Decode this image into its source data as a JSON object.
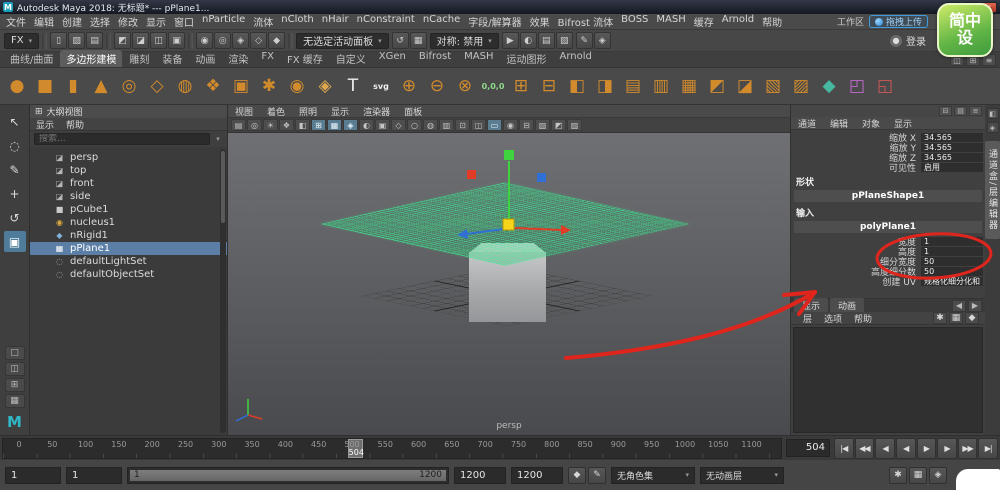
{
  "titlebar": {
    "app_initial": "M",
    "title": "Autodesk Maya 2018: 无标题* --- pPlane1...",
    "window_buttons": {
      "minimize": "─",
      "maximize": "□",
      "close": "×"
    }
  },
  "menubar": {
    "items": [
      "文件",
      "编辑",
      "创建",
      "选择",
      "修改",
      "显示",
      "窗口",
      "nParticle",
      "流体",
      "nCloth",
      "nHair",
      "nConstraint",
      "nCache",
      "字段/解算器",
      "效果",
      "Bifrost 流体",
      "BOSS",
      "MASH",
      "缓存",
      "Arnold",
      "帮助"
    ],
    "workspace_label": "工作区",
    "upload_button": "拖拽上传"
  },
  "statusline": {
    "menuset": "FX",
    "groups": {
      "file": [
        {
          "name": "new-scene",
          "g": "▯"
        },
        {
          "name": "open-scene",
          "g": "▨"
        },
        {
          "name": "save-scene",
          "g": "▤"
        }
      ],
      "selection": [
        {
          "name": "select-hierarchy",
          "g": "◩"
        },
        {
          "name": "select-object",
          "g": "◪"
        },
        {
          "name": "select-component",
          "g": "◫"
        },
        {
          "name": "highlight-mode",
          "g": "▣"
        }
      ],
      "snap": [
        {
          "name": "snap-grid",
          "g": "◉"
        },
        {
          "name": "snap-curve",
          "g": "◎"
        },
        {
          "name": "snap-point",
          "g": "◈"
        },
        {
          "name": "snap-plane",
          "g": "◇"
        },
        {
          "name": "snap-view",
          "g": "◆"
        }
      ],
      "history": [
        {
          "name": "construction-history",
          "g": "↺"
        },
        {
          "name": "list-inputs",
          "g": "▦"
        }
      ],
      "render": [
        {
          "name": "render-current-frame",
          "g": "▶"
        },
        {
          "name": "ipr-render",
          "g": "◐"
        },
        {
          "name": "render-settings",
          "g": "▤"
        },
        {
          "name": "display-layer",
          "g": "▧"
        }
      ],
      "extra": [
        {
          "name": "paint-effects",
          "g": "✎"
        },
        {
          "name": "hypershade",
          "g": "◈"
        }
      ]
    },
    "active_panel": "无选定活动面板",
    "symmetry": "对称: 禁用",
    "login_label": "登录"
  },
  "shelf": {
    "tabs": [
      "曲线/曲面",
      "多边形建模",
      "雕刻",
      "装备",
      "动画",
      "渲染",
      "FX",
      "FX 缓存",
      "自定义",
      "XGen",
      "Bifrost",
      "MASH",
      "运动图形",
      "Arnold"
    ],
    "active_index": 1,
    "icons": [
      {
        "name": "poly-sphere",
        "g": "●",
        "c": "#d28b2c"
      },
      {
        "name": "poly-cube",
        "g": "■",
        "c": "#d28b2c"
      },
      {
        "name": "poly-cylinder",
        "g": "▮",
        "c": "#d28b2c"
      },
      {
        "name": "poly-cone",
        "g": "▲",
        "c": "#d28b2c"
      },
      {
        "name": "poly-torus",
        "g": "◎",
        "c": "#d28b2c"
      },
      {
        "name": "poly-plane",
        "g": "◇",
        "c": "#d28b2c"
      },
      {
        "name": "poly-disc",
        "g": "◍",
        "c": "#d28b2c"
      },
      {
        "name": "poly-platonic",
        "g": "❖",
        "c": "#d28b2c"
      },
      {
        "name": "poly-pipe",
        "g": "▣",
        "c": "#d28b2c"
      },
      {
        "name": "poly-helix",
        "g": "✱",
        "c": "#d28b2c"
      },
      {
        "name": "poly-gear",
        "g": "◉",
        "c": "#d28b2c"
      },
      {
        "name": "poly-super-shape",
        "g": "◈",
        "c": "#e0a84e"
      },
      {
        "name": "type-tool",
        "g": "T",
        "c": "#f0f0f0"
      },
      {
        "name": "svg-tool",
        "g": "svg",
        "c": "#f0f0f0"
      },
      {
        "name": "boolean-union",
        "g": "⊕",
        "c": "#d28b2c"
      },
      {
        "name": "boolean-difference",
        "g": "⊖",
        "c": "#d28b2c"
      },
      {
        "name": "boolean-intersection",
        "g": "⊗",
        "c": "#d28b2c"
      },
      {
        "name": "snap-to-origin",
        "g": "0,0,0",
        "c": "#8fd98b"
      },
      {
        "name": "combine",
        "g": "⊞",
        "c": "#d28b2c"
      },
      {
        "name": "separate",
        "g": "⊟",
        "c": "#d28b2c"
      },
      {
        "name": "extrude",
        "g": "◧",
        "c": "#d28b2c"
      },
      {
        "name": "bevel",
        "g": "◨",
        "c": "#d28b2c"
      },
      {
        "name": "bridge",
        "g": "▤",
        "c": "#d28b2c"
      },
      {
        "name": "multi-cut",
        "g": "▥",
        "c": "#d28b2c"
      },
      {
        "name": "quad-draw",
        "g": "▦",
        "c": "#d28b2c"
      },
      {
        "name": "mirror",
        "g": "◩",
        "c": "#d28b2c"
      },
      {
        "name": "smooth",
        "g": "◪",
        "c": "#d28b2c"
      },
      {
        "name": "reduce",
        "g": "▧",
        "c": "#d28b2c"
      },
      {
        "name": "spin-edge",
        "g": "▨",
        "c": "#d28b2c"
      },
      {
        "name": "target-weld",
        "g": "◆",
        "c": "#46b8a0"
      },
      {
        "name": "project-curve",
        "g": "◰",
        "c": "#c46ad2"
      },
      {
        "name": "align",
        "g": "◱",
        "c": "#d25858"
      }
    ],
    "right_icons": [
      {
        "name": "shelf-editor",
        "g": "◫"
      },
      {
        "name": "shelf-grid",
        "g": "⊞"
      },
      {
        "name": "shelf-options",
        "g": "≡"
      }
    ]
  },
  "toolbox": {
    "tools": [
      {
        "name": "select-tool",
        "g": "↖",
        "selected": false
      },
      {
        "name": "lasso-select-tool",
        "g": "◌",
        "selected": false
      },
      {
        "name": "paint-select-tool",
        "g": "✎",
        "selected": false
      },
      {
        "name": "move-tool",
        "g": "+",
        "selected": false
      },
      {
        "name": "rotate-tool",
        "g": "↺",
        "selected": false
      },
      {
        "name": "scale-tool",
        "g": "▣",
        "selected": true
      }
    ],
    "layouts": [
      {
        "name": "layout-single",
        "g": "□"
      },
      {
        "name": "layout-two-pane",
        "g": "◫"
      },
      {
        "name": "layout-four-pane",
        "g": "⊞"
      },
      {
        "name": "layout-outliner",
        "g": "▦"
      }
    ],
    "logo": "M"
  },
  "outliner": {
    "title": "大纲视图",
    "menus": [
      "显示",
      "帮助"
    ],
    "search_placeholder": "搜索...",
    "items": [
      {
        "label": "persp",
        "icon_name": "camera-icon",
        "g": "◪",
        "c": "#b5b5b5",
        "selected": false
      },
      {
        "label": "top",
        "icon_name": "camera-icon",
        "g": "◪",
        "c": "#b5b5b5",
        "selected": false
      },
      {
        "label": "front",
        "icon_name": "camera-icon",
        "g": "◪",
        "c": "#b5b5b5",
        "selected": false
      },
      {
        "label": "side",
        "icon_name": "camera-icon",
        "g": "◪",
        "c": "#b5b5b5",
        "selected": false
      },
      {
        "label": "pCube1",
        "icon_name": "poly-cube-icon",
        "g": "■",
        "c": "#c9c9c9",
        "selected": false
      },
      {
        "label": "nucleus1",
        "icon_name": "nucleus-icon",
        "g": "◉",
        "c": "#d9a93f",
        "selected": false
      },
      {
        "label": "nRigid1",
        "icon_name": "nrigid-icon",
        "g": "◆",
        "c": "#7fb2d9",
        "selected": false
      },
      {
        "label": "pPlane1",
        "icon_name": "poly-plane-icon",
        "g": "▦",
        "c": "#ffffff",
        "selected": true
      },
      {
        "label": "defaultLightSet",
        "icon_name": "set-icon",
        "g": "◌",
        "c": "#b5b5b5",
        "selected": false
      },
      {
        "label": "defaultObjectSet",
        "icon_name": "set-icon",
        "g": "◌",
        "c": "#b5b5b5",
        "selected": false
      }
    ]
  },
  "viewport": {
    "menus": [
      "视图",
      "着色",
      "照明",
      "显示",
      "渲染器",
      "面板"
    ],
    "toolbar_icons": [
      {
        "name": "select-camera",
        "g": "▤",
        "on": false
      },
      {
        "name": "lock-camera",
        "g": "◎",
        "on": false
      },
      {
        "name": "camera-attributes",
        "g": "☀",
        "on": false
      },
      {
        "name": "bookmarks",
        "g": "❖",
        "on": false
      },
      {
        "name": "image-plane",
        "g": "◧",
        "on": false
      },
      {
        "name": "2d-pan-zoom",
        "g": "⊞",
        "on": true
      },
      {
        "name": "grid-toggle",
        "g": "▦",
        "on": true
      },
      {
        "name": "film-gate",
        "g": "◈",
        "on": true
      },
      {
        "name": "resolution-gate",
        "g": "◐",
        "on": false
      },
      {
        "name": "gate-mask",
        "g": "▣",
        "on": false
      },
      {
        "name": "field-chart",
        "g": "◇",
        "on": false
      },
      {
        "name": "safe-action",
        "g": "○",
        "on": false
      },
      {
        "name": "safe-title",
        "g": "◍",
        "on": false
      },
      {
        "name": "wireframe-mode",
        "g": "▥",
        "on": false
      },
      {
        "name": "shaded-mode",
        "g": "⊡",
        "on": false
      },
      {
        "name": "textured-mode",
        "g": "◫",
        "on": false
      },
      {
        "name": "use-all-lights",
        "g": "▭",
        "on": true
      },
      {
        "name": "shadows",
        "g": "◉",
        "on": false
      },
      {
        "name": "ambient-occlusion",
        "g": "⊟",
        "on": false
      },
      {
        "name": "motion-blur",
        "g": "▧",
        "on": false
      },
      {
        "name": "multisample-aa",
        "g": "◩",
        "on": false
      },
      {
        "name": "xray-mode",
        "g": "▨",
        "on": false
      }
    ],
    "camera_label": "persp"
  },
  "channelbox": {
    "header_icons": [
      {
        "name": "attribute-editor-toggle",
        "g": "⊟"
      },
      {
        "name": "tool-settings-toggle",
        "g": "▤"
      },
      {
        "name": "channel-menu",
        "g": "≡"
      }
    ],
    "menus": [
      "通道",
      "编辑",
      "对象",
      "显示"
    ],
    "transform_rows": [
      {
        "label": "缩放 X",
        "value": "34.565"
      },
      {
        "label": "缩放 Y",
        "value": "34.565"
      },
      {
        "label": "缩放 Z",
        "value": "34.565"
      },
      {
        "label": "可见性",
        "value": "启用"
      }
    ],
    "shape_header": "形状",
    "shape_node": "pPlaneShape1",
    "inputs_header": "输入",
    "input_node": "polyPlane1",
    "input_rows": [
      {
        "label": "宽度",
        "value": "1"
      },
      {
        "label": "高度",
        "value": "1"
      },
      {
        "label": "细分宽度",
        "value": "50"
      },
      {
        "label": "高度细分数",
        "value": "50"
      },
      {
        "label": "创建 UV",
        "value": "规格化细分化和"
      }
    ],
    "lower_tabs": [
      "显示",
      "动画"
    ],
    "tab_arrows": [
      {
        "name": "prev-layer-tab",
        "g": "◀"
      },
      {
        "name": "next-layer-tab",
        "g": "▶"
      }
    ],
    "layer_menus": [
      "层",
      "选项",
      "帮助"
    ],
    "layer_icons": [
      {
        "name": "new-layer",
        "g": "✱"
      },
      {
        "name": "new-layer-from-selected",
        "g": "▦"
      },
      {
        "name": "move-layer",
        "g": "◆"
      }
    ]
  },
  "rightstrip": {
    "icons": [
      {
        "name": "dock-icon",
        "g": "◧"
      },
      {
        "name": "pin-icon",
        "g": "◈"
      }
    ],
    "tab_label": "通道盒/层编辑器"
  },
  "timeline": {
    "tick_labels": [
      0,
      50,
      100,
      150,
      200,
      250,
      300,
      350,
      400,
      450,
      500,
      550,
      600,
      650,
      700,
      750,
      800,
      850,
      900,
      950,
      1000,
      1050,
      1100
    ],
    "current_frame": "504",
    "frame_field": "504",
    "playback_icons": [
      {
        "name": "go-to-start",
        "g": "|◀"
      },
      {
        "name": "step-back-key",
        "g": "◀◀"
      },
      {
        "name": "step-back-frame",
        "g": "◀"
      },
      {
        "name": "play-backwards",
        "g": "◀"
      },
      {
        "name": "play-forwards",
        "g": "▶"
      },
      {
        "name": "step-forward-frame",
        "g": "▶"
      },
      {
        "name": "step-forward-key",
        "g": "▶▶"
      },
      {
        "name": "go-to-end",
        "g": "▶|"
      }
    ]
  },
  "rangeslider": {
    "animation_start": "1",
    "playback_start": "1",
    "slider_min": "1",
    "slider_max": "1200",
    "playback_end": "1200",
    "animation_end": "1200",
    "character_set": "无角色集",
    "anim_layer": "无动画层",
    "mid_icons": [
      {
        "name": "auto-keyframe",
        "g": "◆"
      },
      {
        "name": "set-key",
        "g": "✎"
      }
    ],
    "right_icons": [
      {
        "name": "preferences-hammer",
        "g": "✱"
      },
      {
        "name": "playback-speed",
        "g": "▦"
      },
      {
        "name": "mute-audio",
        "g": "◈"
      }
    ]
  },
  "watermark": {
    "line1": "简中",
    "line2": "设"
  }
}
